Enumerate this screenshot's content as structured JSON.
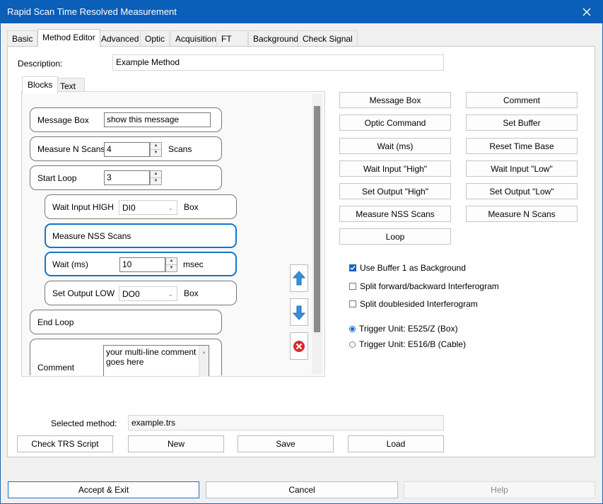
{
  "window": {
    "title": "Rapid Scan Time Resolved Measurement"
  },
  "tabs": [
    "Basic",
    "Method Editor",
    "Advanced",
    "Optic",
    "Acquisition",
    "FT",
    "Background",
    "Check Signal"
  ],
  "description": {
    "label": "Description:",
    "value": "Example Method"
  },
  "editor_tabs": [
    "Blocks",
    "Text"
  ],
  "blocks": {
    "message_box": {
      "label": "Message Box",
      "value": "show this message"
    },
    "measure_n": {
      "label": "Measure N Scans",
      "value": "4",
      "unit": "Scans"
    },
    "start_loop": {
      "label": "Start Loop",
      "value": "3"
    },
    "wait_input": {
      "label": "Wait Input HIGH",
      "value": "DI0",
      "unit": "Box"
    },
    "measure_nss": {
      "label": "Measure NSS Scans"
    },
    "wait_ms": {
      "label": "Wait (ms)",
      "value": "10",
      "unit": "msec"
    },
    "set_output": {
      "label": "Set Output LOW",
      "value": "DO0",
      "unit": "Box"
    },
    "end_loop": {
      "label": "End Loop"
    },
    "comment": {
      "label": "Comment",
      "value_line1": "your multi-line comment",
      "value_line2": "goes here"
    }
  },
  "command_buttons": [
    "Message Box",
    "Comment",
    "Optic Command",
    "Set Buffer",
    "Wait (ms)",
    "Reset Time Base",
    "Wait Input \"High\"",
    "Wait Input \"Low\"",
    "Set Output \"High\"",
    "Set Output \"Low\"",
    "Measure NSS Scans",
    "Measure N Scans",
    "Loop"
  ],
  "options": {
    "use_buffer": {
      "label": "Use Buffer 1 as Background",
      "checked": true
    },
    "split_fb": {
      "label": "Split forward/backward Interferogram",
      "checked": false
    },
    "split_ds": {
      "label": "Split doublesided Interferogram",
      "checked": false
    },
    "trigger_box": {
      "label": "Trigger Unit: E525/Z (Box)",
      "selected": true
    },
    "trigger_cable": {
      "label": "Trigger Unit: E516/B (Cable)",
      "selected": false
    }
  },
  "selected_method": {
    "label": "Selected method:",
    "value": "example.trs"
  },
  "method_buttons": [
    "Check TRS Script",
    "New",
    "Save",
    "Load"
  ],
  "footer_buttons": [
    "Accept & Exit",
    "Cancel",
    "Help"
  ],
  "colors": {
    "titlebar": "#0a5fb8",
    "accent": "#1475c9",
    "delete": "#d92b2b"
  }
}
